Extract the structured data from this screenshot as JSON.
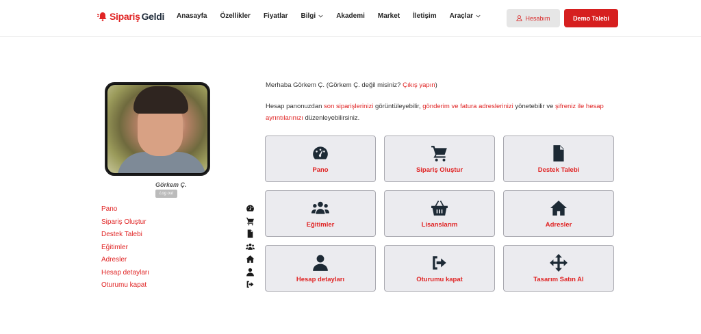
{
  "header": {
    "logo_part1": "Sipariş",
    "logo_part2": "Geldi",
    "nav": [
      {
        "label": "Anasayfa"
      },
      {
        "label": "Özellikler"
      },
      {
        "label": "Fiyatlar"
      },
      {
        "label": "Bilgi",
        "dropdown": true
      },
      {
        "label": "Akademi"
      },
      {
        "label": "Market"
      },
      {
        "label": "İletişim"
      },
      {
        "label": "Araçlar",
        "dropdown": true
      }
    ],
    "account_label": "Hesabım",
    "demo_label": "Demo Talebi"
  },
  "profile": {
    "name": "Görkem Ç.",
    "logout_badge": "Log out"
  },
  "side_menu": [
    {
      "label": "Pano",
      "icon": "dashboard-icon"
    },
    {
      "label": "Sipariş Oluştur",
      "icon": "cart-icon"
    },
    {
      "label": "Destek Talebi",
      "icon": "document-icon"
    },
    {
      "label": "Eğitimler",
      "icon": "users-icon"
    },
    {
      "label": "Adresler",
      "icon": "home-icon"
    },
    {
      "label": "Hesap detayları",
      "icon": "user-icon"
    },
    {
      "label": "Oturumu kapat",
      "icon": "sign-out-icon"
    }
  ],
  "greeting": {
    "prefix": "Merhaba Görkem Ç. (Görkem Ç. değil misiniz? ",
    "link": "Çıkış yapın",
    "suffix": ")"
  },
  "description": {
    "t1": "Hesap panonuzdan ",
    "l1": "son siparişlerinizi",
    "t2": " görüntüleyebilir, ",
    "l2": "gönderim ve fatura adreslerinizi",
    "t3": " yönetebilir ve ",
    "l3": "şifreniz ile hesap ayrıntılarınızı",
    "t4": " düzenleyebilirsiniz."
  },
  "cards": [
    {
      "label": "Pano",
      "icon": "dashboard-icon"
    },
    {
      "label": "Sipariş Oluştur",
      "icon": "cart-icon"
    },
    {
      "label": "Destek Talebi",
      "icon": "document-icon"
    },
    {
      "label": "Eğitimler",
      "icon": "users-icon"
    },
    {
      "label": "Lisanslarım",
      "icon": "basket-icon"
    },
    {
      "label": "Adresler",
      "icon": "home-icon"
    },
    {
      "label": "Hesap detayları",
      "icon": "user-icon"
    },
    {
      "label": "Oturumu kapat",
      "icon": "sign-out-icon"
    },
    {
      "label": "Tasarım Satın Al",
      "icon": "arrows-move-icon"
    }
  ],
  "colors": {
    "accent": "#e02424",
    "demo_button": "#d61f1f",
    "icon": "#1d2a35"
  }
}
